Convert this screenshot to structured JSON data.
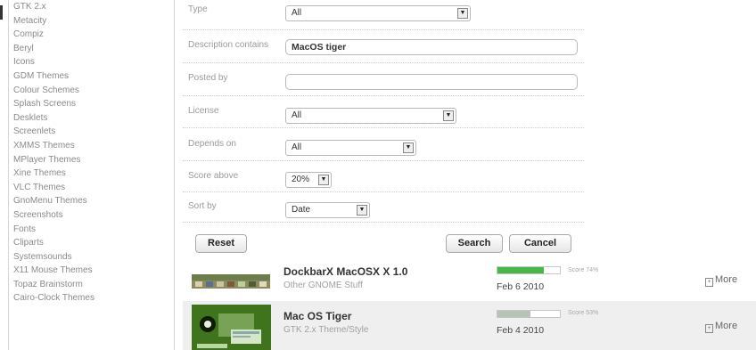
{
  "sidebar": {
    "items": [
      "GTK 2.x",
      "Metacity",
      "Compiz",
      "Beryl",
      "Icons",
      "GDM Themes",
      "Colour Schemes",
      "Splash Screens",
      "Desklets",
      "Screenlets",
      "XMMS Themes",
      "MPlayer Themes",
      "Xine Themes",
      "VLC Themes",
      "GnoMenu Themes",
      "Screenshots",
      "Fonts",
      "Cliparts",
      "Systemsounds",
      "X11 Mouse Themes",
      "Topaz Brainstorm",
      "Cairo-Clock Themes"
    ]
  },
  "form": {
    "type": {
      "label": "Type",
      "value": "All"
    },
    "description": {
      "label": "Description contains",
      "value": "MacOS tiger"
    },
    "posted_by": {
      "label": "Posted by",
      "value": ""
    },
    "license": {
      "label": "License",
      "value": "All"
    },
    "depends_on": {
      "label": "Depends on",
      "value": "All"
    },
    "score_above": {
      "label": "Score above",
      "value": "20%"
    },
    "sort_by": {
      "label": "Sort by",
      "value": "Date"
    },
    "reset_label": "Reset",
    "search_label": "Search",
    "cancel_label": "Cancel"
  },
  "results": [
    {
      "title": "DockbarX MacOSX X 1.0",
      "category": "Other GNOME Stuff",
      "score": 0.74,
      "score_text": "Score 74%",
      "date": "Feb 6 2010",
      "more_label": "More",
      "bar_color": "#45b845"
    },
    {
      "title": "Mac OS Tiger",
      "category": "GTK 2.x Theme/Style",
      "score": 0.53,
      "score_text": "Score 53%",
      "date": "Feb 4 2010",
      "more_label": "More",
      "bar_color": "#b6c4b6"
    }
  ],
  "colors": {
    "accent_green": "#45b845",
    "highlight_row": "#efefef"
  },
  "icons": {
    "dropdown": "dropdown-arrow-icon",
    "more": "more-icon"
  }
}
